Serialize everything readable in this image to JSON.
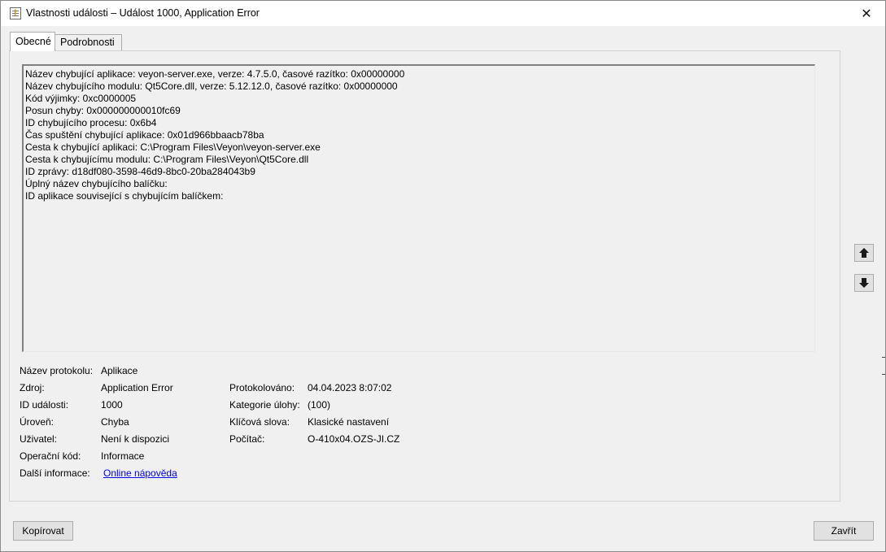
{
  "window": {
    "title": "Vlastnosti události – Událost 1000, Application Error",
    "close_glyph": "✕"
  },
  "tabs": [
    {
      "label": "Obecné",
      "active": true
    },
    {
      "label": "Podrobnosti",
      "active": false
    }
  ],
  "message_lines": [
    "Název chybující aplikace: veyon-server.exe, verze: 4.7.5.0, časové razítko: 0x00000000",
    "Název chybujícího modulu: Qt5Core.dll, verze: 5.12.12.0, časové razítko: 0x00000000",
    "Kód výjimky: 0xc0000005",
    "Posun chyby: 0x000000000010fc69",
    "ID chybujícího procesu: 0x6b4",
    "Čas spuštění chybující aplikace: 0x01d966bbaacb78ba",
    "Cesta k chybující aplikaci: C:\\Program Files\\Veyon\\veyon-server.exe",
    "Cesta k chybujícímu modulu: C:\\Program Files\\Veyon\\Qt5Core.dll",
    "ID zprávy: d18df080-3598-46d9-8bc0-20ba284043b9",
    "Úplný název chybujícího balíčku:",
    "ID aplikace související s chybujícím balíčkem:"
  ],
  "properties": {
    "log_name": {
      "label": "Název protokolu:",
      "value": "Aplikace"
    },
    "source": {
      "label": "Zdroj:",
      "value": "Application Error"
    },
    "logged": {
      "label": "Protokolováno:",
      "value": "04.04.2023 8:07:02"
    },
    "event_id": {
      "label": "ID události:",
      "value": "1000"
    },
    "task_category": {
      "label": "Kategorie úlohy:",
      "value": "(100)"
    },
    "level": {
      "label": "Úroveň:",
      "value": "Chyba"
    },
    "keywords": {
      "label": "Klíčová slova:",
      "value": "Klasické nastavení"
    },
    "user": {
      "label": "Uživatel:",
      "value": "Není k dispozici"
    },
    "computer": {
      "label": "Počítač:",
      "value": "O-410x04.OZS-JI.CZ"
    },
    "opcode": {
      "label": "Operační kód:",
      "value": "Informace"
    },
    "more_info": {
      "label": "Další informace:",
      "value": "Online nápověda"
    }
  },
  "nav": {
    "up_icon": "arrow-up-icon",
    "down_icon": "arrow-down-icon"
  },
  "buttons": {
    "copy_label": "Kopírovat",
    "close_label": "Zavřít"
  },
  "colors": {
    "link": "#0000ee",
    "background": "#f0f0f0"
  }
}
